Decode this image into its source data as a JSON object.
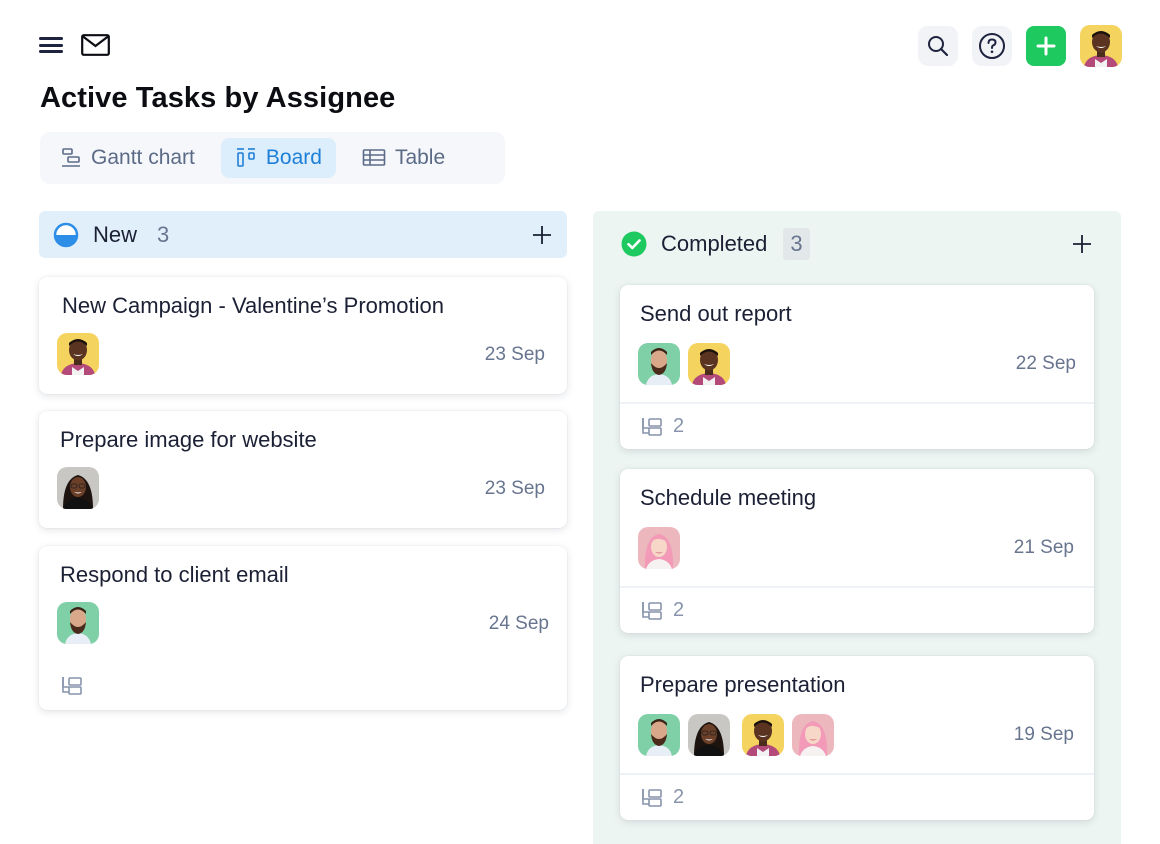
{
  "header": {
    "menu_icon": "hamburger-menu-icon",
    "mail_icon": "mail-icon",
    "actions": {
      "search_icon": "search-icon",
      "help_icon": "help-circle-icon",
      "add_icon": "plus-icon",
      "add_color": "#1ec95f",
      "user_avatar": "avatar-man-yellow"
    }
  },
  "page": {
    "title": "Active Tasks by Assignee"
  },
  "view_tabs": [
    {
      "label": "Gantt chart",
      "icon": "gantt-icon",
      "active": false
    },
    {
      "label": "Board",
      "icon": "board-icon",
      "active": true
    },
    {
      "label": "Table",
      "icon": "table-icon",
      "active": false
    }
  ],
  "columns": {
    "new": {
      "title": "New",
      "count": "3",
      "status_icon": "half-circle-status-icon",
      "accent": "#2d8ee8",
      "cards": [
        {
          "title": "New Campaign - Valentine’s Promotion",
          "date": "23 Sep",
          "assignees": [
            "avatar-man-yellow"
          ],
          "subtasks": null
        },
        {
          "title": "Prepare image for website",
          "date": "23 Sep",
          "assignees": [
            "avatar-woman-glasses"
          ],
          "subtasks": null
        },
        {
          "title": "Respond to client email",
          "date": "24 Sep",
          "assignees": [
            "avatar-man-beard"
          ],
          "subtasks": ""
        }
      ]
    },
    "completed": {
      "title": "Completed",
      "count": "3",
      "status_icon": "check-circle-icon",
      "accent": "#1ec95f",
      "cards": [
        {
          "title": "Send out report",
          "date": "22 Sep",
          "assignees": [
            "avatar-man-beard",
            "avatar-man-yellow"
          ],
          "subtasks": "2"
        },
        {
          "title": "Schedule meeting",
          "date": "21 Sep",
          "assignees": [
            "avatar-woman-pink"
          ],
          "subtasks": "2"
        },
        {
          "title": "Prepare presentation",
          "date": "19 Sep",
          "assignees": [
            "avatar-man-beard",
            "avatar-woman-glasses",
            "avatar-man-yellow",
            "avatar-woman-pink"
          ],
          "subtasks": "2"
        }
      ]
    }
  }
}
